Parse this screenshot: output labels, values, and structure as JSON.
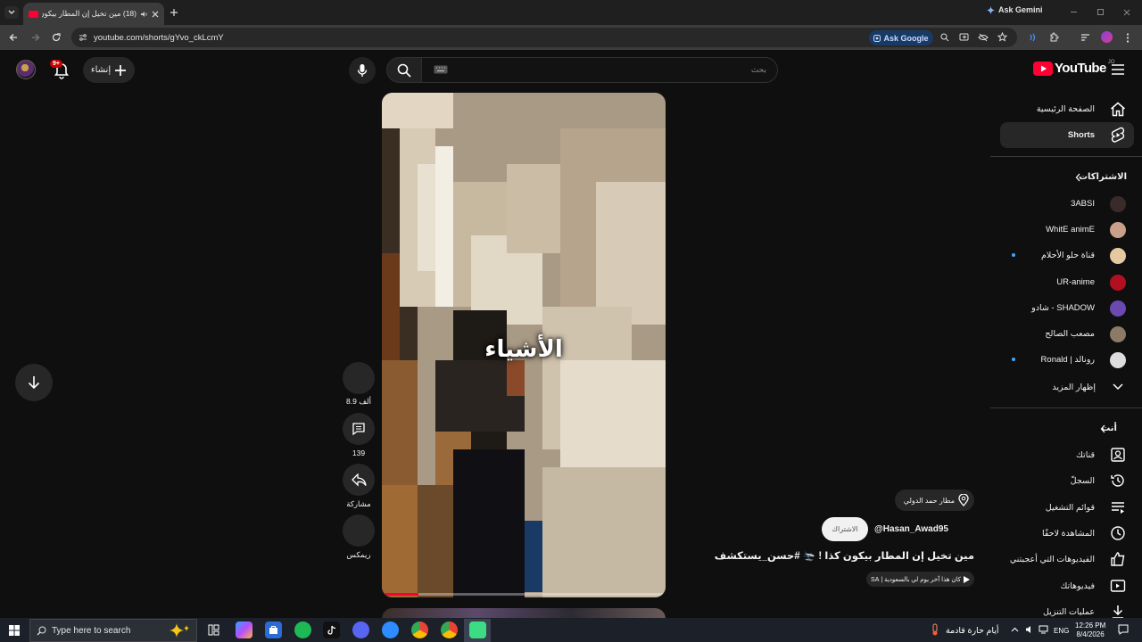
{
  "browser": {
    "tab_title": "(18) مين تخيل إن المطار بيكون",
    "url": "youtube.com/shorts/gYvo_ckLcmY",
    "ask_google_label": "Ask Google",
    "ask_gemini_label": "Ask Gemini"
  },
  "header": {
    "logo_text": "YouTube",
    "country_code": "JO",
    "search_placeholder": "بحث",
    "create_label": "إنشاء",
    "notification_count": "9+"
  },
  "sidebar": {
    "home_label": "الصفحة الرئيسية",
    "shorts_label": "Shorts",
    "subscriptions_heading": "الاشتراكات",
    "subscriptions": [
      {
        "name": "3ABSI",
        "color": "#3a2a2a",
        "dot": false
      },
      {
        "name": "WhitE animE",
        "color": "#c9a08a",
        "dot": false
      },
      {
        "name": "قناة حلو الأحلام",
        "color": "#e6c9a0",
        "dot": true
      },
      {
        "name": "UR-anime",
        "color": "#b01020",
        "dot": false
      },
      {
        "name": "SHADOW - شادو",
        "color": "#6a4ab0",
        "dot": false
      },
      {
        "name": "مصعب الصالح",
        "color": "#8a7a66",
        "dot": false
      },
      {
        "name": "رونالد | Ronald",
        "color": "#dddddd",
        "dot": true
      }
    ],
    "show_more_label": "إظهار المزيد",
    "you_heading": "أنت",
    "you_items": [
      {
        "label": "قناتك",
        "icon": "channel-icon"
      },
      {
        "label": "السجلّ",
        "icon": "history-icon"
      },
      {
        "label": "قوائم التشغيل",
        "icon": "playlists-icon"
      },
      {
        "label": "المشاهدة لاحقًا",
        "icon": "watch-later-icon"
      },
      {
        "label": "الفيديوهات التي أعجبتني",
        "icon": "liked-icon"
      },
      {
        "label": "فيديوهاتك",
        "icon": "your-videos-icon"
      },
      {
        "label": "عمليات التنزيل",
        "icon": "downloads-icon"
      }
    ]
  },
  "short": {
    "caption": "الأشياء",
    "progress": 0.13,
    "likes": "8.9 ألف",
    "comments": "139",
    "share_label": "مشاركة",
    "remix_label": "ريمكس",
    "location": "مطار حمد الدولي",
    "channel_handle": "@Hasan_Awad95",
    "subscribe_label": "الاشتراك",
    "title": "مين تخيل إن المطار بيكون كذا ! 🛬 #حسن_يستكشف",
    "audio": "كان هذا آخر يوم لي بالسعودية | SA"
  },
  "taskbar": {
    "search_placeholder": "Type here to search",
    "weather": "أيام حارة قادمة",
    "language": "ENG",
    "time": "12:26 PM",
    "date": "8/4/2026"
  }
}
